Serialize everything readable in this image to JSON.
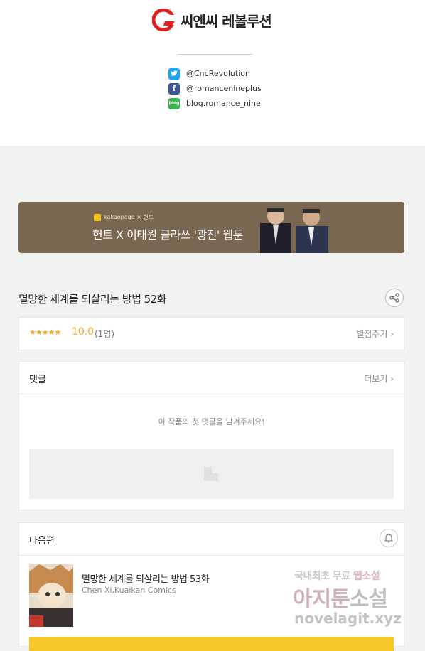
{
  "brand": {
    "name": "씨엔씨 레볼루션",
    "accent": "#e02020"
  },
  "social": [
    {
      "icon": "twitter-icon",
      "handle": "@CncRevolution"
    },
    {
      "icon": "facebook-icon",
      "handle": "@romancenineplus"
    },
    {
      "icon": "naver-blog-icon",
      "handle": "blog.romance_nine"
    }
  ],
  "banner": {
    "tag": "kakaopage × 헌트",
    "title": "헌트 X 이태원 클라쓰 '광진' 웹툰",
    "bg_color": "#7a6751"
  },
  "episode": {
    "title": "멸망한 세계를 되살리는 방법 52화"
  },
  "rating": {
    "stars": "★★★★★",
    "score": "10.0",
    "count": "(1명)",
    "action": "별점주기 ›",
    "color": "#f5a623"
  },
  "comments": {
    "title": "댓글",
    "more": "더보기 ›",
    "empty_message": "이 작품의 첫 댓글을 남겨주세요!"
  },
  "next": {
    "section_title": "다음편",
    "title": "멸망한 세계를 되살리는 방법 53화",
    "author": "Chen Xi,Kuaikan Comics",
    "button_color": "#f7c72a"
  },
  "watermark": {
    "line1a": "국내최초 무료",
    "line1b": "웹소설",
    "line2a": "아지툰",
    "line2b": "소설",
    "line3": "novelagit.xyz"
  }
}
